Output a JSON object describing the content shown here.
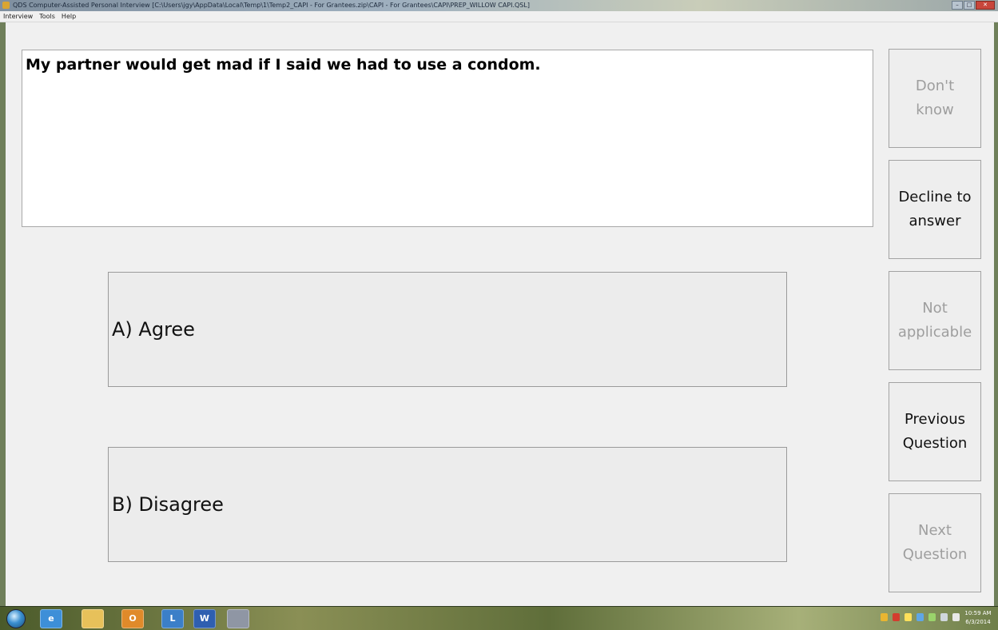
{
  "window": {
    "title": "QDS Computer-Assisted Personal Interview [C:\\Users\\jgy\\AppData\\Local\\Temp\\1\\Temp2_CAPI - For Grantees.zip\\CAPI - For Grantees\\CAPI\\PREP_WILLOW CAPI.QSL]"
  },
  "menu": [
    "Interview",
    "Tools",
    "Help"
  ],
  "question": {
    "text": "My partner would get mad if I said we had to use a condom."
  },
  "answers": [
    {
      "label": "A) Agree"
    },
    {
      "label": "B) Disagree"
    }
  ],
  "side_buttons": {
    "dont_know": "Don't\nknow",
    "decline": "Decline to\nanswer",
    "not_applicable": "Not\napplicable",
    "previous": "Previous\nQuestion",
    "next": "Next\nQuestion"
  },
  "taskbar": {
    "apps": [
      "start-orb",
      "internet-explorer-icon",
      "folder-icon",
      "outlook-icon",
      "lync-icon",
      "word-icon",
      "app-icon"
    ],
    "word_letter": "W",
    "outlook_letter": "O",
    "lync_letter": "L",
    "clock_time": "10:59 AM",
    "clock_date": "6/3/2014"
  },
  "colors": {
    "disabled_text": "#9e9e9e",
    "button_face": "#eeeeee",
    "panel": "#f0f0f0"
  }
}
